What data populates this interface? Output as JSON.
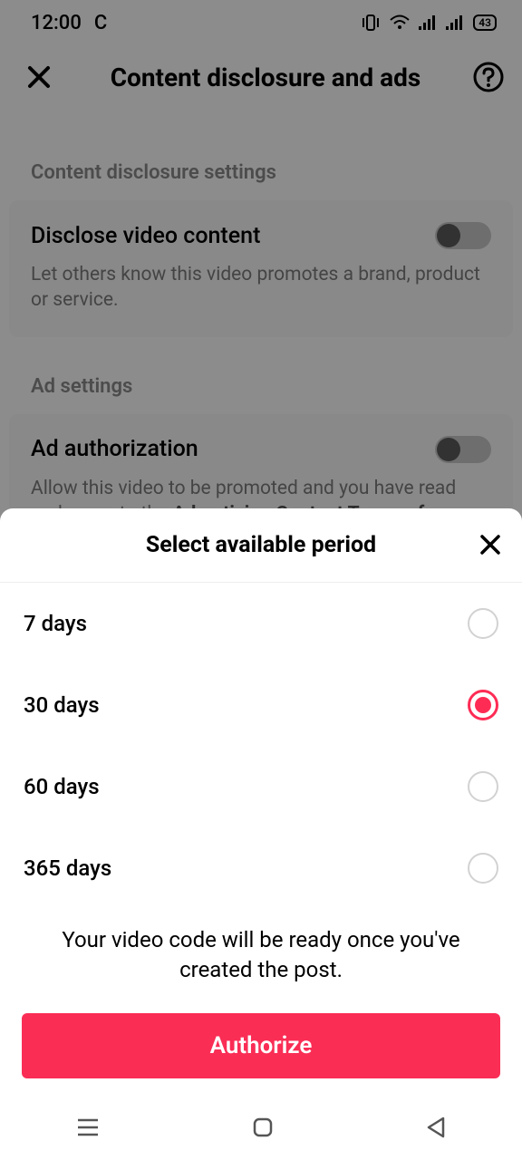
{
  "status": {
    "time": "12:00",
    "carrier": "C",
    "battery": "43"
  },
  "header": {
    "title": "Content disclosure and ads"
  },
  "section1": {
    "label": "Content disclosure settings"
  },
  "disclose": {
    "title": "Disclose video content",
    "sub": "Let others know this video promotes a brand, product or service."
  },
  "section2": {
    "label": "Ad settings"
  },
  "adauth": {
    "title": "Ad authorization",
    "sub_pre": "Allow this video to be promoted and you have read and agree to the ",
    "sub_bold": "Advertising Content Terms of Service"
  },
  "sheet": {
    "title": "Select available period",
    "options": [
      "7 days",
      "30 days",
      "60 days",
      "365 days"
    ],
    "selected_index": 1,
    "hint": "Your video code will be ready once you've created the post.",
    "button": "Authorize"
  }
}
